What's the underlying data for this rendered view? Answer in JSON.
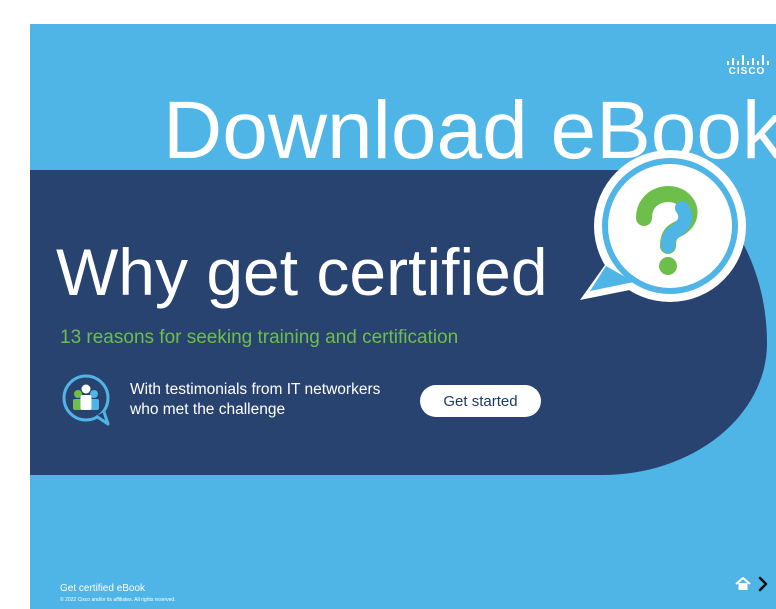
{
  "brand": {
    "logo_text": "CISCO",
    "colors": {
      "sky_blue": "#4fb4e6",
      "navy": "#28436f",
      "green": "#6dbe4b",
      "white": "#ffffff"
    }
  },
  "header": {
    "title": "Download eBook"
  },
  "hero": {
    "headline": "Why get certified",
    "subheadline": "13 reasons for seeking training and certification",
    "testimonial_text": "With testimonials from IT networkers who met the challenge",
    "cta_label": "Get started",
    "icons": [
      "question-bubble-icon",
      "people-chat-icon"
    ]
  },
  "footer": {
    "title": "Get certified eBook",
    "copyright": "© 2022 Cisco and/or its affiliates. All rights reserved.",
    "nav_icons": [
      "home-icon",
      "next-arrow-icon"
    ]
  }
}
